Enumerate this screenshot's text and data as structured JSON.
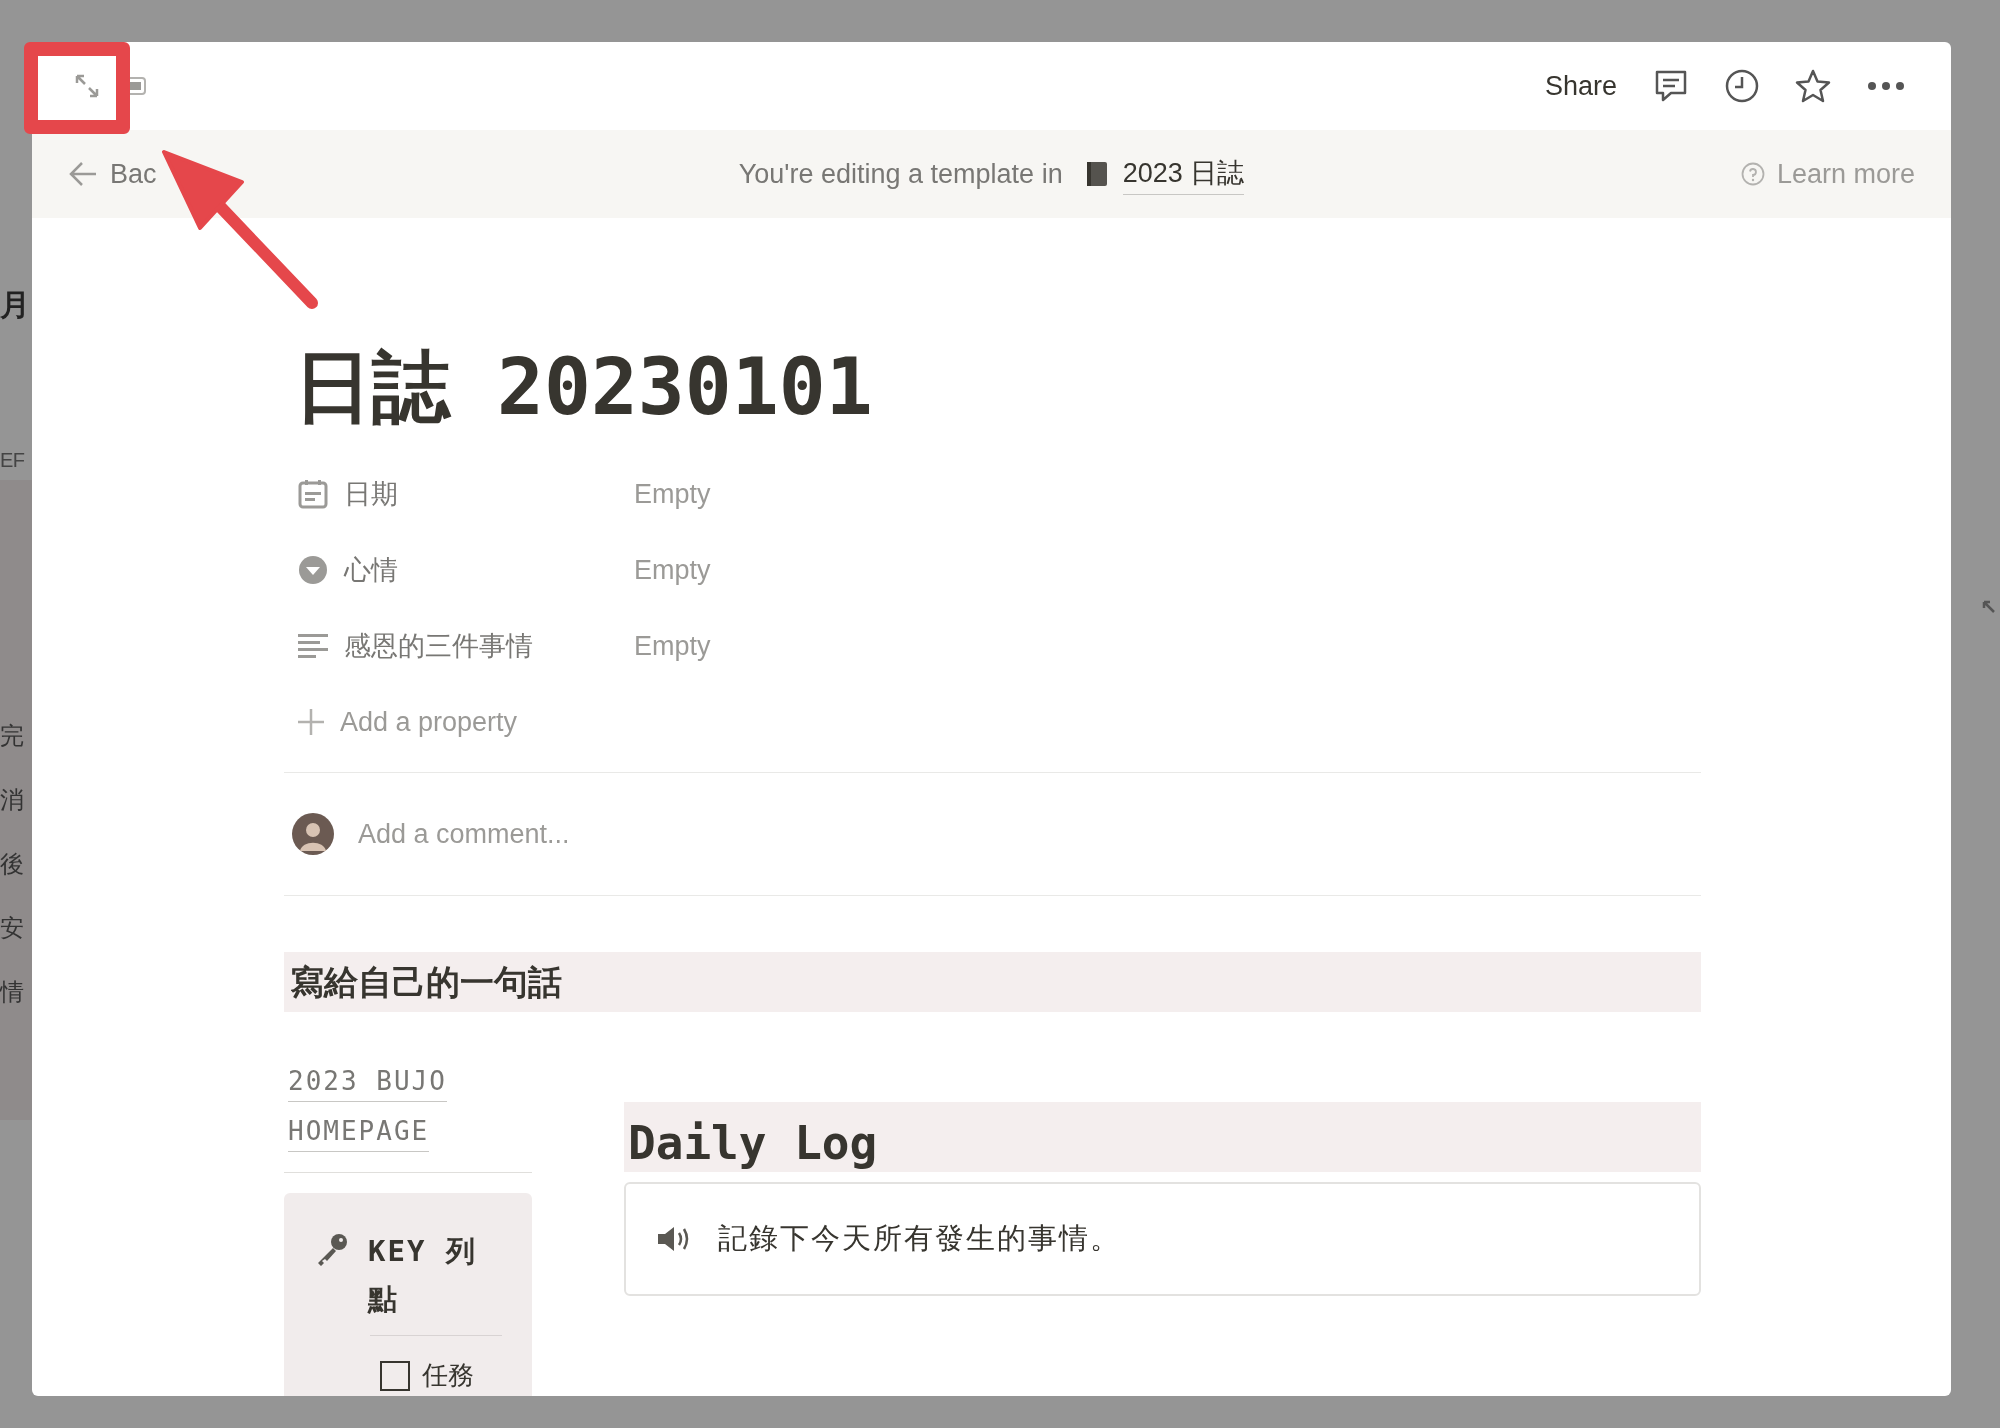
{
  "backdrop": {
    "texts": [
      "月",
      "EF",
      "完",
      "消",
      "後",
      "安",
      "情"
    ]
  },
  "topbar": {
    "share": "Share"
  },
  "banner": {
    "back": "Bac",
    "message": "You're editing a template in",
    "database": "2023 日誌",
    "learn_more": "Learn more"
  },
  "page": {
    "title": "日誌 20230101",
    "properties": [
      {
        "kind": "date",
        "name": "日期",
        "value": "Empty"
      },
      {
        "kind": "select",
        "name": "心情",
        "value": "Empty"
      },
      {
        "kind": "text",
        "name": "感恩的三件事情",
        "value": "Empty"
      }
    ],
    "add_property": "Add a property",
    "comment_placeholder": "Add a comment...",
    "heading": "寫給自己的一句話",
    "links": [
      "2023 BUJO",
      "HOMEPAGE"
    ],
    "key_card": {
      "title": "KEY 列點",
      "items": [
        {
          "label": "任務",
          "checked": false
        }
      ]
    },
    "daily_log": {
      "heading": "Daily Log",
      "callout": "記錄下今天所有發生的事情。"
    }
  }
}
